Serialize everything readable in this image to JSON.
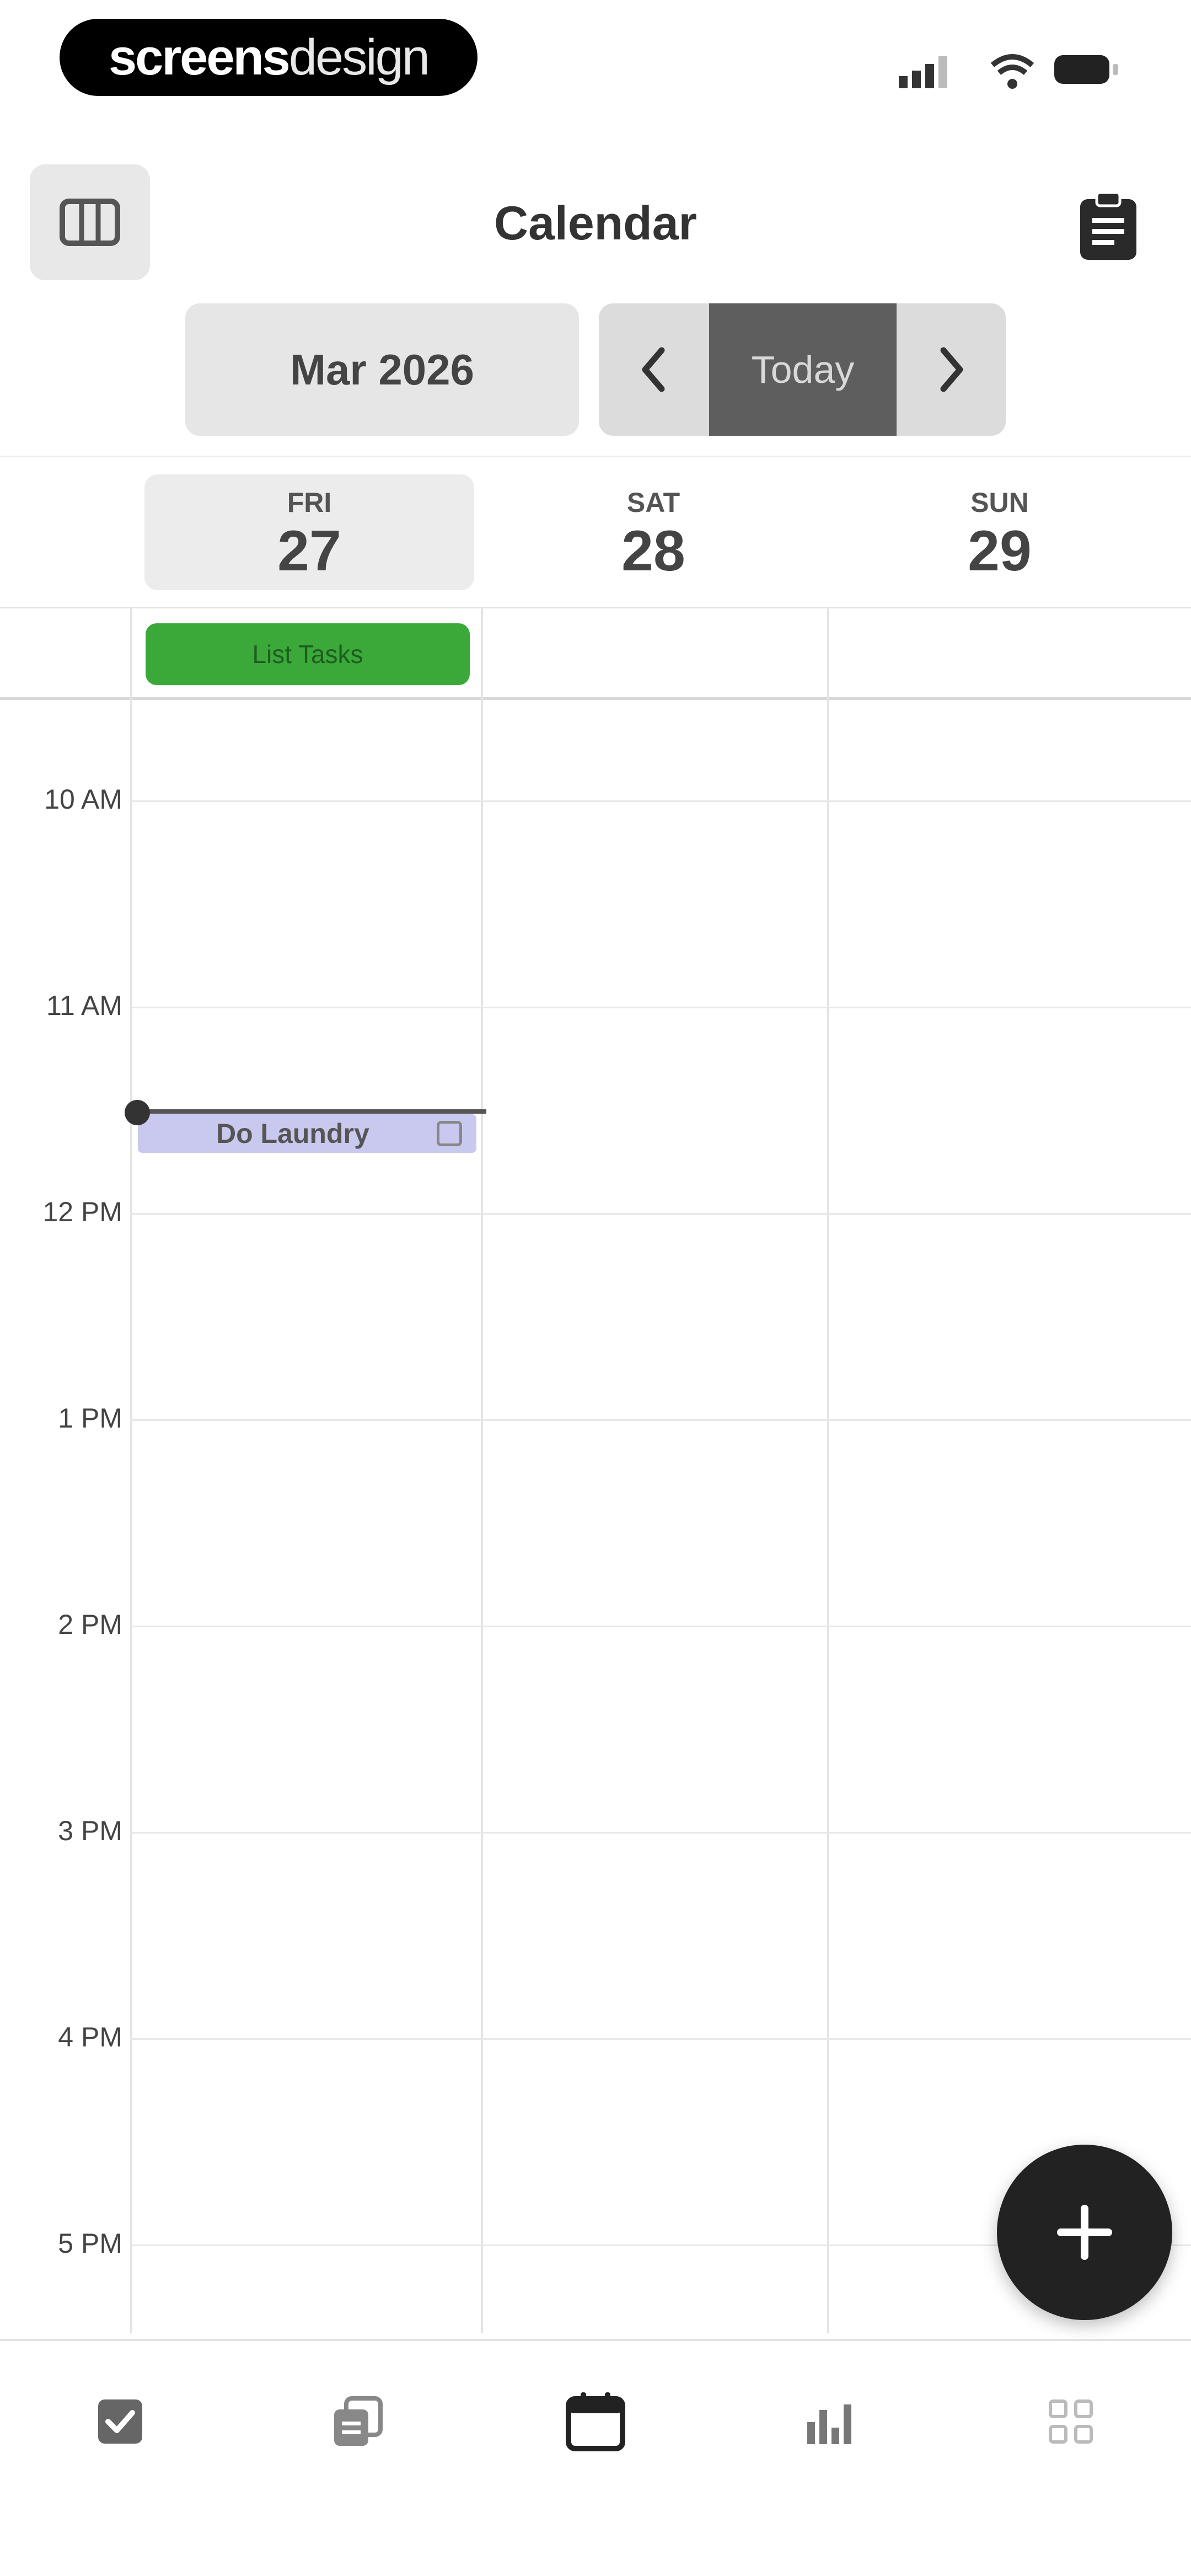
{
  "brand": {
    "part1": "screens",
    "part2": "design"
  },
  "header": {
    "title": "Calendar"
  },
  "nav": {
    "month_label": "Mar 2026",
    "today_label": "Today"
  },
  "days": [
    {
      "dow": "FRI",
      "num": "27",
      "selected": true
    },
    {
      "dow": "SAT",
      "num": "28",
      "selected": false
    },
    {
      "dow": "SUN",
      "num": "29",
      "selected": false
    }
  ],
  "all_day_events": [
    {
      "title": "List Tasks",
      "color": "#3aa93a"
    }
  ],
  "hours": [
    "10 AM",
    "11 AM",
    "12 PM",
    "1 PM",
    "2 PM",
    "3 PM",
    "4 PM",
    "5 PM"
  ],
  "timed_events": [
    {
      "title": "Do Laundry",
      "color": "#c9c8ef"
    }
  ],
  "tabs": [
    {
      "icon": "checkbox-icon",
      "active": false
    },
    {
      "icon": "notes-icon",
      "active": false
    },
    {
      "icon": "calendar-icon",
      "active": true
    },
    {
      "icon": "stats-icon",
      "active": false
    },
    {
      "icon": "grid-icon",
      "active": false
    }
  ],
  "colors": {
    "accent_dark": "#222222",
    "today_button": "#5e5e5e",
    "event_green": "#3aa93a",
    "event_lavender": "#c9c8ef"
  }
}
